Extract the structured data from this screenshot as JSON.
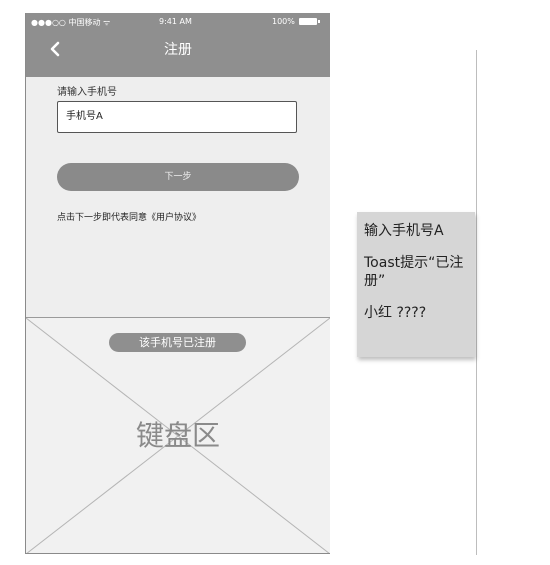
{
  "status_bar": {
    "carrier": "●●●○○ 中国移动 ᯤ",
    "time": "9:41 AM",
    "battery": "100%"
  },
  "nav": {
    "title": "注册",
    "back_icon": "chevron-left-icon"
  },
  "form": {
    "phone_label": "请输入手机号",
    "phone_value": "手机号A",
    "next_button": "下一步",
    "agreement": "点击下一步即代表同意《用户协议》"
  },
  "toast": {
    "text": "该手机号已注册"
  },
  "keyboard": {
    "label": "键盘区"
  },
  "note": {
    "lines": [
      "输入手机号A",
      "Toast提示“已注册”",
      "小红 ????"
    ]
  },
  "colors": {
    "bar": "#8f8f8f",
    "screen": "#eeeeee",
    "note": "#d6d6d6"
  }
}
